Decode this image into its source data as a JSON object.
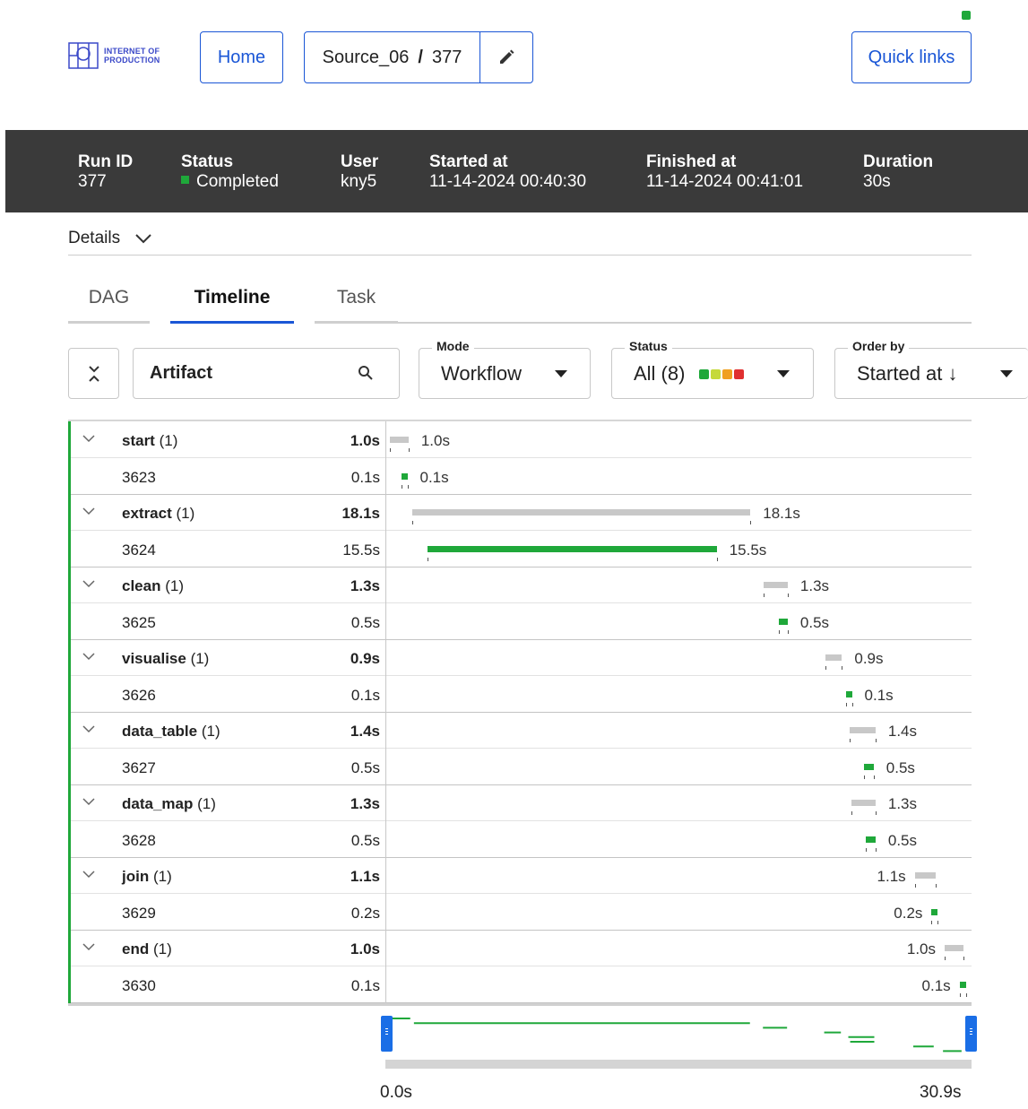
{
  "header": {
    "logo_line1": "INTERNET OF",
    "logo_line2": "PRODUCTION",
    "home_label": "Home",
    "source_name": "Source_06",
    "source_sep": "/",
    "run_number": "377",
    "quick_links_label": "Quick links"
  },
  "run": {
    "run_id_label": "Run ID",
    "run_id": "377",
    "status_label": "Status",
    "status": "Completed",
    "user_label": "User",
    "user": "kny5",
    "started_label": "Started at",
    "started": "11-14-2024 00:40:30",
    "finished_label": "Finished at",
    "finished": "11-14-2024 00:41:01",
    "duration_label": "Duration",
    "duration": "30s"
  },
  "details_label": "Details",
  "tabs": [
    {
      "label": "DAG",
      "active": false
    },
    {
      "label": "Timeline",
      "active": true
    },
    {
      "label": "Task",
      "active": false
    }
  ],
  "filters": {
    "search_label": "Artifact",
    "mode_legend": "Mode",
    "mode_value": "Workflow",
    "status_legend": "Status",
    "status_value": "All (8)",
    "status_colors": [
      "#1fa83a",
      "#c5d93a",
      "#f0a020",
      "#e03030"
    ],
    "order_legend": "Order by",
    "order_value": "Started at ↓"
  },
  "timeline": {
    "total_seconds": 30.9,
    "steps": [
      {
        "name": "start",
        "count": "(1)",
        "duration": "1.0s",
        "start": 0.0,
        "dur": 1.0,
        "task": {
          "id": "3623",
          "duration": "0.1s",
          "start": 0.6,
          "dur": 0.1
        }
      },
      {
        "name": "extract",
        "count": "(1)",
        "duration": "18.1s",
        "start": 1.2,
        "dur": 18.1,
        "task": {
          "id": "3624",
          "duration": "15.5s",
          "start": 2.0,
          "dur": 15.5
        }
      },
      {
        "name": "clean",
        "count": "(1)",
        "duration": "1.3s",
        "start": 20.0,
        "dur": 1.3,
        "task": {
          "id": "3625",
          "duration": "0.5s",
          "start": 20.8,
          "dur": 0.5
        }
      },
      {
        "name": "visualise",
        "count": "(1)",
        "duration": "0.9s",
        "start": 23.3,
        "dur": 0.9,
        "task": {
          "id": "3626",
          "duration": "0.1s",
          "start": 24.4,
          "dur": 0.1
        }
      },
      {
        "name": "data_table",
        "count": "(1)",
        "duration": "1.4s",
        "start": 24.6,
        "dur": 1.4,
        "task": {
          "id": "3627",
          "duration": "0.5s",
          "start": 25.4,
          "dur": 0.5
        }
      },
      {
        "name": "data_map",
        "count": "(1)",
        "duration": "1.3s",
        "start": 24.7,
        "dur": 1.3,
        "task": {
          "id": "3628",
          "duration": "0.5s",
          "start": 25.5,
          "dur": 0.5
        }
      },
      {
        "name": "join",
        "count": "(1)",
        "duration": "1.1s",
        "start": 28.1,
        "dur": 1.1,
        "task": {
          "id": "3629",
          "duration": "0.2s",
          "start": 29.0,
          "dur": 0.2
        }
      },
      {
        "name": "end",
        "count": "(1)",
        "duration": "1.0s",
        "start": 29.7,
        "dur": 1.0,
        "task": {
          "id": "3630",
          "duration": "0.1s",
          "start": 30.5,
          "dur": 0.1
        }
      }
    ]
  },
  "axis": {
    "start_label": "0.0s",
    "end_label": "30.9s"
  }
}
